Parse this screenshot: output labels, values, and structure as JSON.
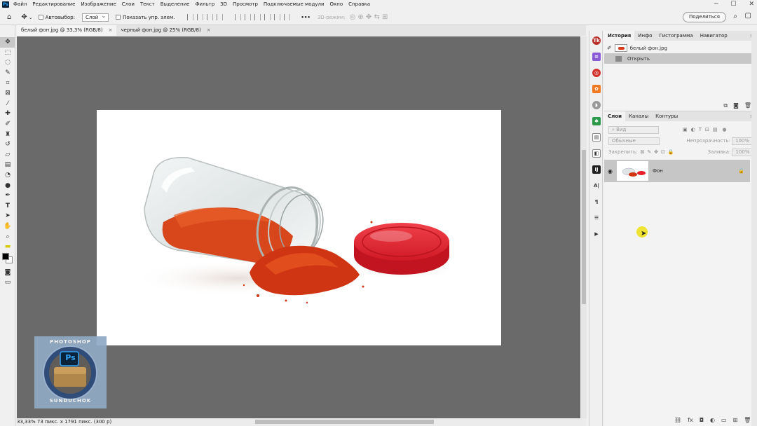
{
  "menu": {
    "app_icon": "Ps",
    "items": [
      "Файл",
      "Редактирование",
      "Изображение",
      "Слои",
      "Текст",
      "Выделение",
      "Фильтр",
      "3D",
      "Просмотр",
      "Подключаемые модули",
      "Окно",
      "Справка"
    ],
    "window_controls": {
      "minimize": "─",
      "maximize": "☐",
      "close": "✕"
    }
  },
  "options": {
    "autoselect_label": "Автовыбор:",
    "autoselect_value": "Слой",
    "show_transform_label": "Показать упр. элем.",
    "more_label": "•••",
    "mode3d_label": "3D-режим:",
    "share_label": "Поделиться"
  },
  "tabs": [
    {
      "label": "белый фон.jpg @ 33,3% (RGB/8)",
      "close": "×"
    },
    {
      "label": "черный фон.jpg @ 25% (RGB/8)",
      "close": "×"
    }
  ],
  "status": {
    "text": "33,33%   73 пикс. x 1791 пикс. (300 p)"
  },
  "history_panel": {
    "tabs": [
      "История",
      "Инфо",
      "Гистограмма",
      "Навигатор"
    ],
    "snapshot_label": "белый фон.jpg",
    "items": [
      {
        "label": "Открыть"
      }
    ]
  },
  "layers_panel": {
    "tabs": [
      "Слои",
      "Каналы",
      "Контуры"
    ],
    "filter_placeholder": "Вид",
    "blend_mode": "Обычные",
    "opacity_label": "Непрозрачность:",
    "opacity_value": "100%",
    "lock_label": "Закрепить:",
    "fill_label": "Заливка:",
    "fill_value": "100%",
    "layers": [
      {
        "name": "Фон",
        "locked": true
      }
    ]
  },
  "watermark": {
    "text_top": "PHOTOSHOP",
    "text_bottom": "SUNDUCHOK",
    "badge": "Ps"
  },
  "colors": {
    "accent_red": "#d93a1b",
    "lid_red": "#e8202c",
    "canvas_bg": "#6a6a6a",
    "highlight": "#ece10e"
  }
}
